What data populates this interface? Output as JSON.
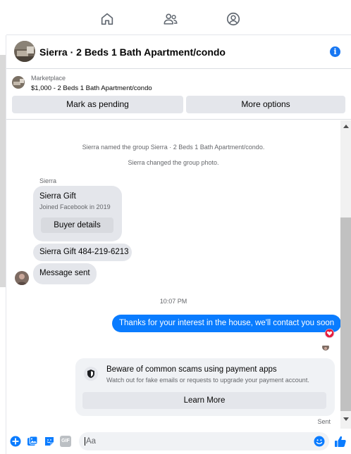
{
  "header": {
    "title": "Sierra · 2 Beds 1 Bath Apartment/condo",
    "info_icon": "info-icon",
    "info_glyph": "i"
  },
  "marketplace": {
    "label": "Marketplace",
    "listing": "$1,000 - 2 Beds 1 Bath Apartment/condo",
    "mark_pending_label": "Mark as pending",
    "more_options_label": "More options"
  },
  "chat": {
    "system_messages": [
      "Sierra named the group Sierra · 2 Beds 1 Bath Apartment/condo.",
      "Sierra changed the group photo."
    ],
    "sender_name": "Sierra",
    "profile_card": {
      "name": "Sierra Gift",
      "subtitle": "Joined Facebook in 2019",
      "button_label": "Buyer details"
    },
    "incoming_messages": [
      "Sierra Gift 484-219-6213",
      "Message sent"
    ],
    "timestamp": "10:07 PM",
    "outgoing_message": "Thanks for your interest in the house, we'll contact you soon",
    "scam_warning": {
      "title": "Beware of common scams using payment apps",
      "subtitle": "Watch out for fake emails or requests to upgrade your payment account.",
      "button_label": "Learn More"
    },
    "status": "Sent"
  },
  "composer": {
    "placeholder": "Aa",
    "gif_label": "GIF"
  },
  "colors": {
    "accent": "#1877f2",
    "outgoing_bubble": "#0a7cff",
    "heart": "#e41e3f"
  }
}
